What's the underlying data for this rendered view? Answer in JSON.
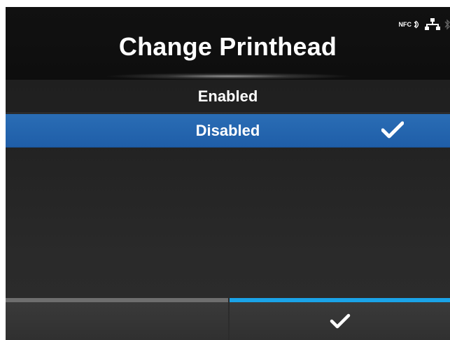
{
  "header": {
    "title": "Change Printhead",
    "status_icons": [
      "nfc-icon",
      "network-icon",
      "bluetooth-icon"
    ],
    "nfc_label": "NFC"
  },
  "options": [
    {
      "label": "Enabled",
      "selected": false
    },
    {
      "label": "Disabled",
      "selected": true
    }
  ],
  "footer": {
    "left_button": "",
    "confirm_icon": "checkmark-icon"
  },
  "colors": {
    "selection": "#2366b0",
    "confirm_accent": "#1aa3e8",
    "left_accent": "#6e6e6e"
  }
}
